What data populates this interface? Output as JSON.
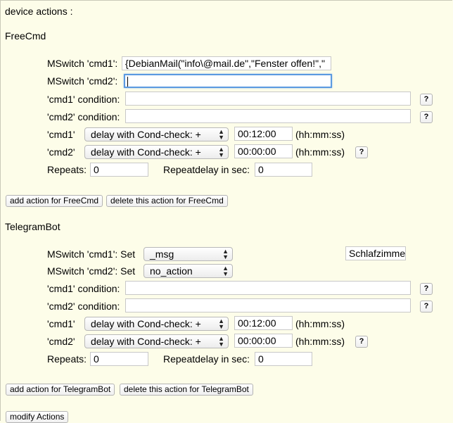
{
  "header": {
    "title": "device actions :"
  },
  "free_cmd": {
    "section_title": "FreeCmd",
    "cmd1_label": "MSwitch 'cmd1':",
    "cmd1_value": "{DebianMail(\"info\\@mail.de\",\"Fenster offen!\",\"",
    "cmd2_label": "MSwitch 'cmd2':",
    "cmd2_value": "",
    "cmd1_condition_label": "'cmd1' condition:",
    "cmd1_condition_value": "",
    "cmd2_condition_label": "'cmd2' condition:",
    "cmd2_condition_value": "",
    "cmd1_delay_label": "'cmd1'",
    "cmd1_delay_mode": "delay with Cond-check: +",
    "cmd1_delay_time": "00:12:00",
    "cmd2_delay_label": "'cmd2'",
    "cmd2_delay_mode": "delay with Cond-check: +",
    "cmd2_delay_time": "00:00:00",
    "time_format": "(hh:mm:ss)",
    "repeats_label": "Repeats:",
    "repeats_value": "0",
    "repeatdelay_label": "Repeatdelay in sec:",
    "repeatdelay_value": "0",
    "help_label": "?",
    "add_button": "add action for FreeCmd",
    "delete_button": "delete this action for FreeCmd"
  },
  "telegram": {
    "section_title": "TelegramBot",
    "cmd1_label": "MSwitch 'cmd1': Set",
    "cmd1_select": "_msg",
    "cmd1_value": "Schlafzimme",
    "cmd2_label": "MSwitch 'cmd2': Set",
    "cmd2_select": "no_action",
    "cmd1_condition_label": "'cmd1' condition:",
    "cmd1_condition_value": "",
    "cmd2_condition_label": "'cmd2' condition:",
    "cmd2_condition_value": "",
    "cmd1_delay_label": "'cmd1'",
    "cmd1_delay_mode": "delay with Cond-check: +",
    "cmd1_delay_time": "00:12:00",
    "cmd2_delay_label": "'cmd2'",
    "cmd2_delay_mode": "delay with Cond-check: +",
    "cmd2_delay_time": "00:00:00",
    "time_format": "(hh:mm:ss)",
    "repeats_label": "Repeats:",
    "repeats_value": "0",
    "repeatdelay_label": "Repeatdelay in sec:",
    "repeatdelay_value": "0",
    "help_label": "?",
    "add_button": "add action for TelegramBot",
    "delete_button": "delete this action for TelegramBot"
  },
  "footer": {
    "modify_button": "modify Actions"
  },
  "icons": {
    "select_arrow": "updown-arrows-icon",
    "help": "question-mark-icon"
  }
}
